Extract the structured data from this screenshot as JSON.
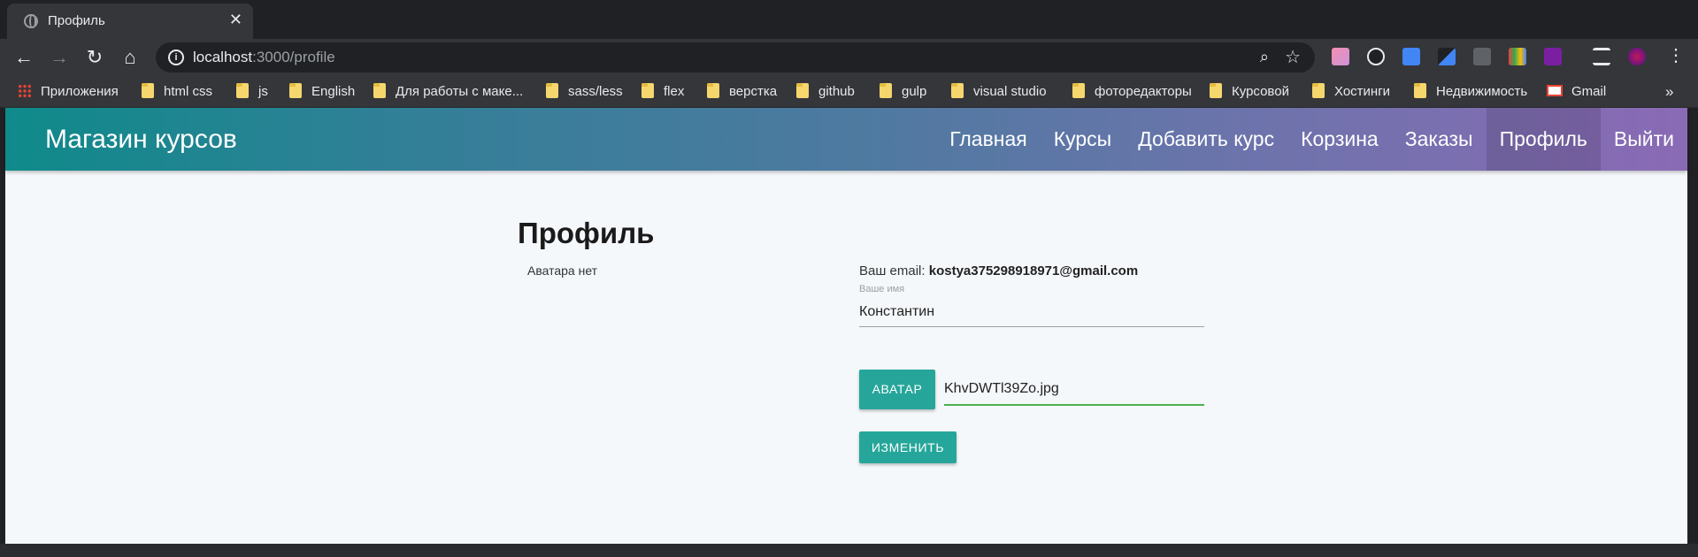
{
  "browser": {
    "tab": {
      "title": "Профиль",
      "close": "✕"
    },
    "toolbar": {
      "back": "←",
      "forward": "→",
      "reload": "↻",
      "home": "⌂",
      "url_host": "localhost",
      "url_path": ":3000/profile",
      "info_icon": "i",
      "zoom_icon": "⌕",
      "star_icon": "☆",
      "menu_icon": "⋮"
    },
    "bookmarks": [
      {
        "label": "Приложения",
        "icon": "apps-icon"
      },
      {
        "label": "html css",
        "icon": "folder-icon"
      },
      {
        "label": "js",
        "icon": "folder-icon"
      },
      {
        "label": "English",
        "icon": "folder-icon"
      },
      {
        "label": "Для работы с маке...",
        "icon": "folder-icon"
      },
      {
        "label": "sass/less",
        "icon": "folder-icon"
      },
      {
        "label": "flex",
        "icon": "folder-icon"
      },
      {
        "label": "верстка",
        "icon": "folder-icon"
      },
      {
        "label": "github",
        "icon": "folder-icon"
      },
      {
        "label": "gulp",
        "icon": "folder-icon"
      },
      {
        "label": "visual studio",
        "icon": "folder-icon"
      },
      {
        "label": "фоторедакторы",
        "icon": "folder-icon"
      },
      {
        "label": "Курсовой",
        "icon": "folder-icon"
      },
      {
        "label": "Хостинги",
        "icon": "folder-icon"
      },
      {
        "label": "Недвижимость",
        "icon": "folder-icon"
      },
      {
        "label": "Gmail",
        "icon": "gmail-icon"
      }
    ],
    "bookmarks_more": "»"
  },
  "site": {
    "brand": "Магазин курсов",
    "nav": [
      "Главная",
      "Курсы",
      "Добавить курс",
      "Корзина",
      "Заказы",
      "Профиль",
      "Выйти"
    ],
    "active_nav": "Профиль"
  },
  "profile": {
    "title": "Профиль",
    "no_avatar": "Аватара нет",
    "email_label": "Ваш email:",
    "email_value": "kostya375298918971@gmail.com",
    "name_label": "Ваше имя",
    "name_value": "Константин",
    "avatar_button": "Аватар",
    "file_name": "KhvDWTl39Zo.jpg",
    "submit_button": "Изменить"
  },
  "colors": {
    "accent": "#26a69a",
    "nav_gradient_start": "#0f8a8a",
    "nav_gradient_end": "#8a6ab5",
    "file_underline": "#4caf50"
  }
}
